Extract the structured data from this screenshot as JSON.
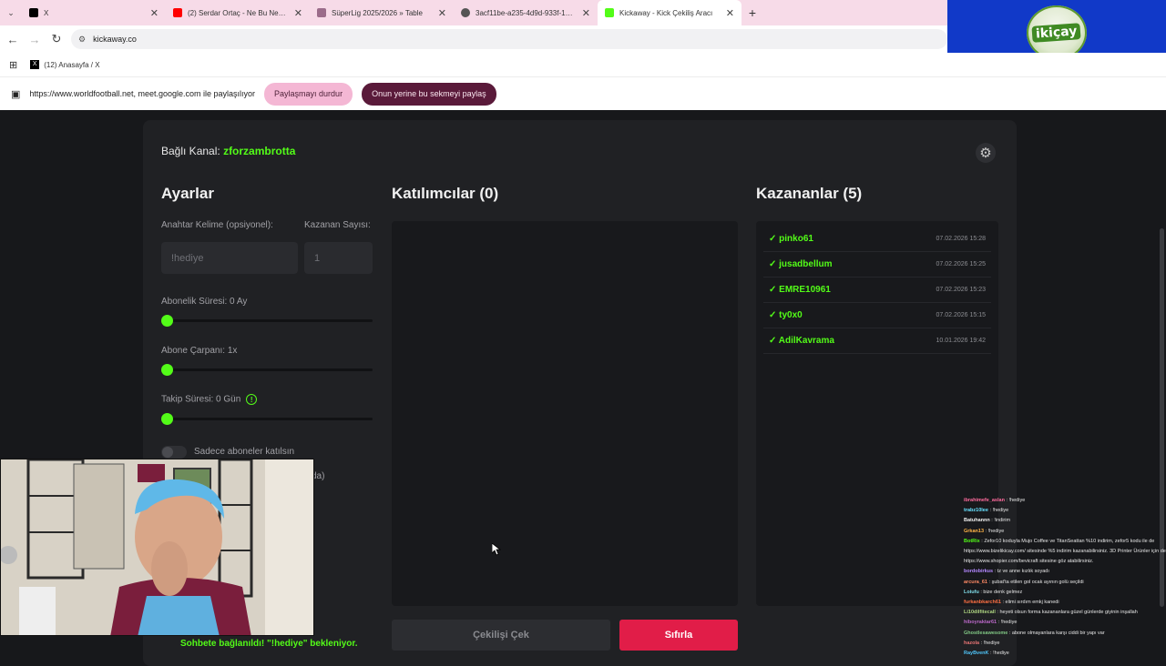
{
  "browser": {
    "tabs": [
      {
        "title": "X",
        "favicon_color": "#000000",
        "active": false
      },
      {
        "title": "(2) Serdar Ortaç - Ne Bu Neşe -",
        "favicon_color": "#ff0000",
        "active": false
      },
      {
        "title": "SüperLig 2025/2026 » Table",
        "favicon_color": "#9b6c8a",
        "active": false
      },
      {
        "title": "3acf11be-a235-4d9d-933f-17e7f",
        "favicon_color": "#555555",
        "active": false
      },
      {
        "title": "Kickaway - Kick Çekiliş Aracı",
        "favicon_color": "#53fc18",
        "active": true
      }
    ],
    "url": "kickaway.co",
    "bookmark": "(12) Anasayfa / X",
    "share_text": "https://www.worldfootball.net, meet.google.com ile paylaşılıyor",
    "stop_share_label": "Paylaşmayı durdur",
    "share_tab_label": "Onun yerine bu sekmeyi paylaş"
  },
  "overlay_logo": "ikiçay",
  "app": {
    "kanal_label": "Bağlı Kanal:",
    "kanal_name": "zforzambrotta",
    "settings": {
      "title": "Ayarlar",
      "keyword_label": "Anahtar Kelime (opsiyonel):",
      "keyword_value": "!hediye",
      "winner_count_label": "Kazanan Sayısı:",
      "winner_count_value": "1",
      "sub_duration_label": "Abonelik Süresi: 0 Ay",
      "sub_duration_value": 0,
      "sub_multiplier_label": "Abone Çarpanı: 1x",
      "sub_multiplier_value": 0,
      "follow_duration_label": "Takip Süresi: 0 Gün",
      "follow_duration_value": 0,
      "subs_only_label": "Sadece aboneler katılsın",
      "partial_label": "da)"
    },
    "participants": {
      "title": "Katılımcılar (0)"
    },
    "winners": {
      "title": "Kazananlar (5)",
      "items": [
        {
          "name": "✓ pinko61",
          "date": "07.02.2026 15:28"
        },
        {
          "name": "✓ jusadbellum",
          "date": "07.02.2026 15:25"
        },
        {
          "name": "✓ EMRE10961",
          "date": "07.02.2026 15:23"
        },
        {
          "name": "✓ ty0x0",
          "date": "07.02.2026 15:15"
        },
        {
          "name": "✓ AdilKavrama",
          "date": "10.01.2026 19:42"
        }
      ]
    },
    "draw_label": "Çekilişi Çek",
    "reset_label": "Sıfırla",
    "status_text": "Sohbete bağlanıldı! \"!hediye\" bekleniyor."
  },
  "chat": [
    {
      "user": "ibrahimefe_aslan",
      "msg": ": !hediye",
      "color": "#ff6b9d"
    },
    {
      "user": "trabz10lee",
      "msg": ": !hediye",
      "color": "#66e0ff"
    },
    {
      "user": "Batuhannn",
      "msg": ": !indirim",
      "color": "#f0f0f0"
    },
    {
      "user": "Grkan13",
      "msg": ": !hediye",
      "color": "#ffb347"
    },
    {
      "user": "BotRix",
      "msg": ": Zefor10 koduyla Mujo Coffee ve TitanSeattan %10 indirim, zefor5 kodu ile de https://www.bizelikicay.com/ sitesinde %5 indirim kazanabilirsiniz. 3D Printer Ürünler için de https://www.shopier.com/bevicraft sitesine göz atabilirsiniz.",
      "color": "#53fc18"
    },
    {
      "user": "bordobirkus",
      "msg": ": tz ve anne kızlık soyadı",
      "color": "#b388ff"
    },
    {
      "user": "arcura_61",
      "msg": ": şubat'ta etilen gol ocak ayının golü seçildi",
      "color": "#ff8a65"
    },
    {
      "user": "Loiufu",
      "msg": ": bize denk gelmez",
      "color": "#80deea"
    },
    {
      "user": "furkanbkarch61",
      "msg": ": elimi sırdım emkj kanedi",
      "color": "#ff7043"
    },
    {
      "user": "Li10dilfitecall",
      "msg": ": heyeti olsun forma kazananlara güzel günlerde giyinin inşallah",
      "color": "#aed581"
    },
    {
      "user": "hiboyraktar61",
      "msg": ": !hediye",
      "color": "#ba68c8"
    },
    {
      "user": "Ghostlesawesome",
      "msg": ": abone olmayanlara karşı ciddi bir yapı var",
      "color": "#81c784"
    },
    {
      "user": "hazola",
      "msg": ": !hediye",
      "color": "#e57373"
    },
    {
      "user": "RayBvenK",
      "msg": ": !hediye",
      "color": "#4fc3f7"
    }
  ]
}
